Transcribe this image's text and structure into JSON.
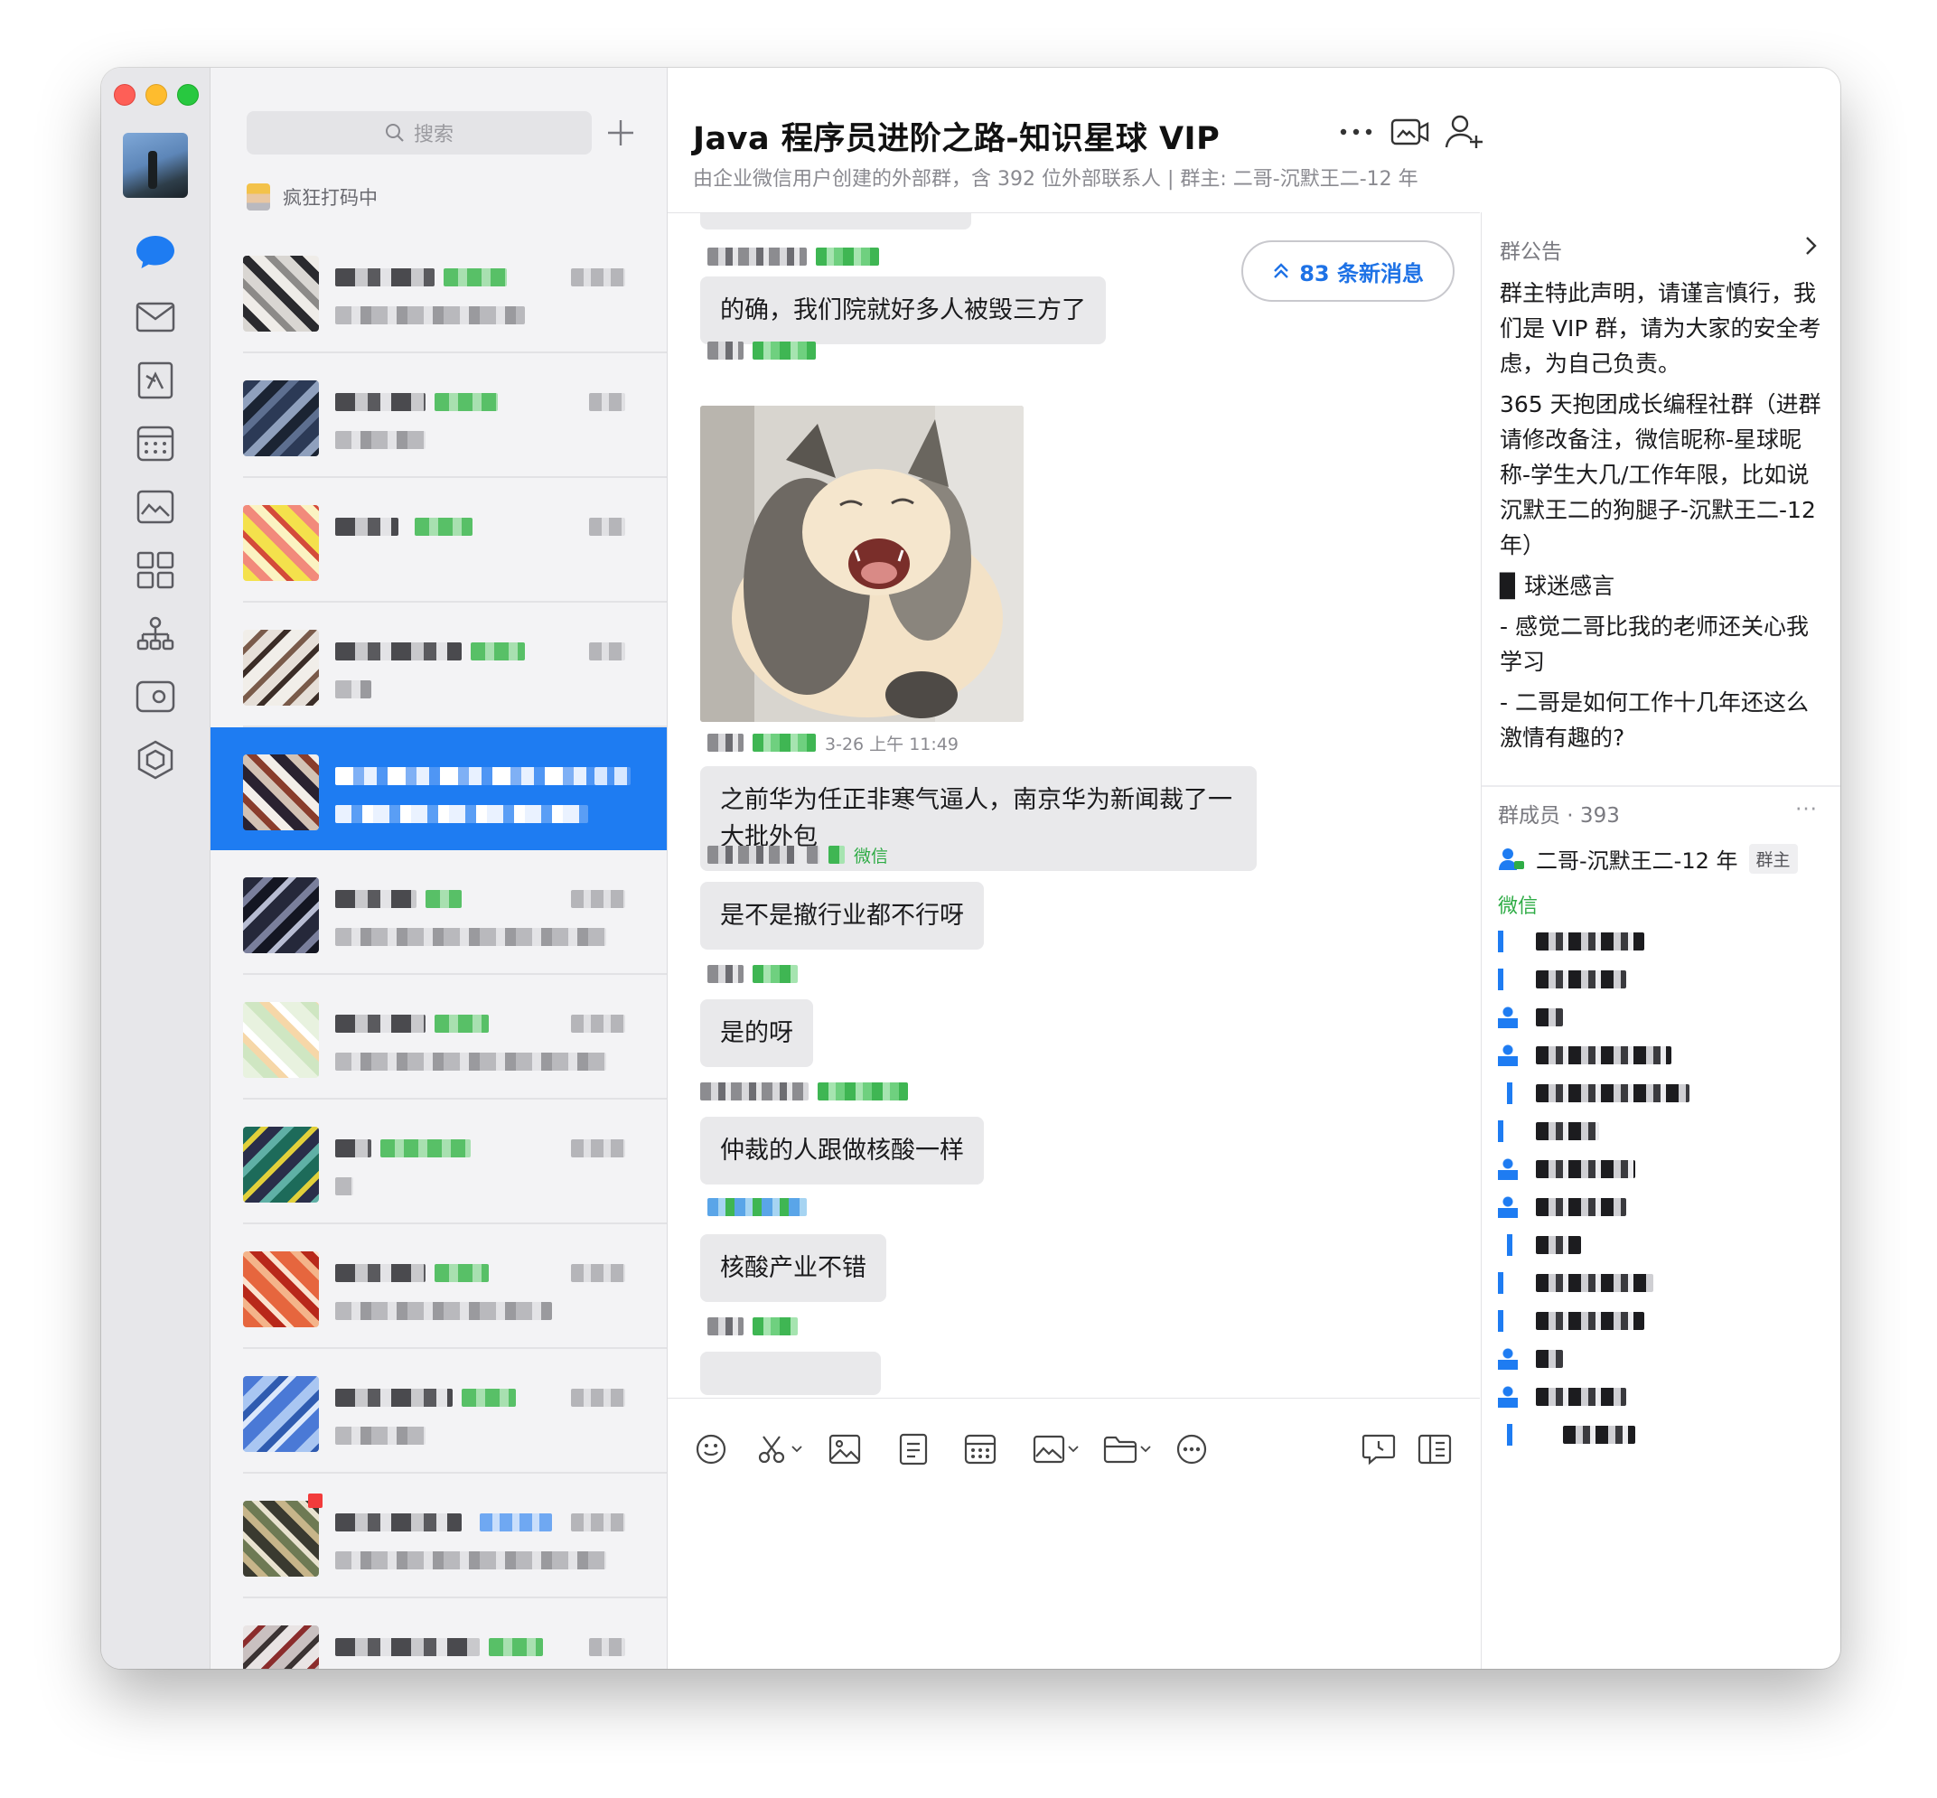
{
  "app": {
    "status_text": "疯狂打码中",
    "search_placeholder": "搜索"
  },
  "rail": {
    "items": [
      "messages-icon",
      "mail-icon",
      "docs-icon",
      "calendar-icon",
      "drive-icon",
      "workbench-icon",
      "contacts-icon",
      "meeting-icon",
      "apps-icon"
    ]
  },
  "chat": {
    "title": "Java 程序员进阶之路-知识星球 VIP",
    "subtitle": "由企业微信用户创建的外部群，含 392 位外部联系人 | 群主: 二哥-沉默王二-12 年",
    "new_messages": "83 条新消息",
    "image_time": "3-26 上午 11:49",
    "wechat_tag": "微信",
    "messages": [
      "的确，我们院就好多人被毁三方了",
      "之前华为任正非寒气逼人，南京华为新闻裁了一大批外包",
      "是不是撤行业都不行呀",
      "是的呀",
      "仲裁的人跟做核酸一样",
      "核酸产业不错"
    ]
  },
  "side": {
    "notice_title": "群公告",
    "notice": [
      "群主特此声明，请谨言慎行，我们是 VIP 群，请为大家的安全考虑，为自己负责。",
      "365 天抱团成长编程社群（进群请修改备注，微信昵称-星球昵称-学生大几/工作年限，比如说沉默王二的狗腿子-沉默王二-12 年）",
      "▉ 球迷感言",
      "- 感觉二哥比我的老师还关心我学习",
      "- 二哥是如何工作十几年还这么激情有趣的?"
    ],
    "members_label": "群成员 · 393",
    "more": "···",
    "owner_name": "二哥-沉默王二-12 年",
    "owner_tag": "群主",
    "wechat_group": "微信"
  },
  "colors": {
    "accent": "#1e7cf2",
    "wechat_green": "#2fac46",
    "bubble": "#e9e9eb",
    "rail_bg": "#e7e7ea",
    "list_bg": "#f3f3f5"
  }
}
